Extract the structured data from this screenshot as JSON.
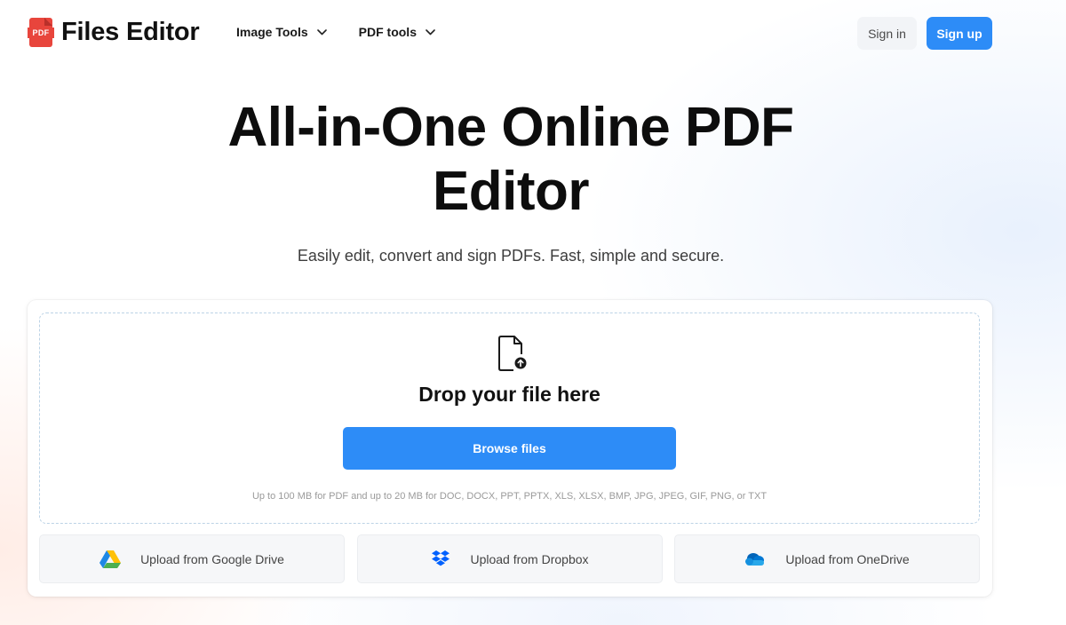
{
  "header": {
    "brand_badge": "PDF",
    "brand_name": "Files Editor",
    "nav": [
      {
        "label": "Image Tools"
      },
      {
        "label": "PDF tools"
      }
    ],
    "signin_label": "Sign in",
    "signup_label": "Sign up"
  },
  "hero": {
    "title_line1": "All-in-One Online PDF",
    "title_line2": "Editor",
    "subtitle": "Easily edit, convert and sign PDFs. Fast, simple and secure."
  },
  "upload": {
    "drop_title": "Drop your file here",
    "browse_label": "Browse files",
    "limits_text": "Up to 100 MB for PDF and up to 20 MB for DOC, DOCX, PPT, PPTX, XLS, XLSX, BMP, JPG, JPEG, GIF, PNG, or TXT",
    "sources": [
      {
        "label": "Upload from Google Drive",
        "icon": "google-drive-icon"
      },
      {
        "label": "Upload from Dropbox",
        "icon": "dropbox-icon"
      },
      {
        "label": "Upload from OneDrive",
        "icon": "onedrive-icon"
      }
    ]
  },
  "colors": {
    "primary": "#2d8cf7",
    "brand_red": "#e8453c"
  }
}
